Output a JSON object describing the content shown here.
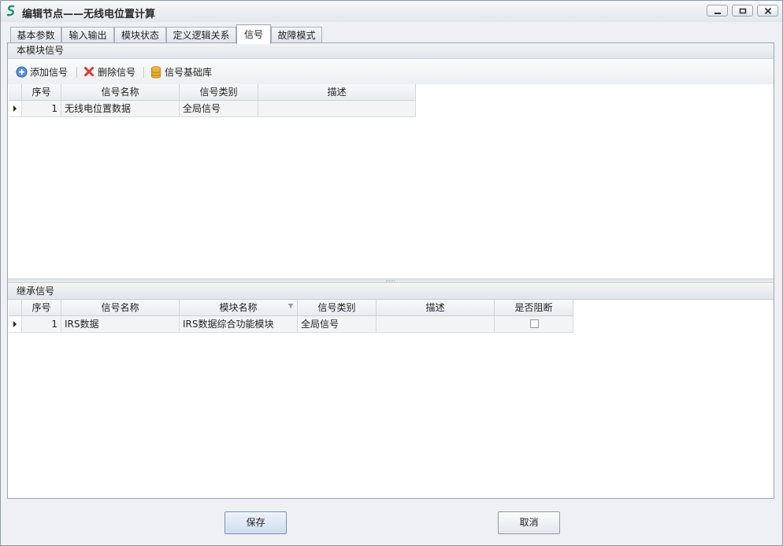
{
  "window": {
    "title": "编辑节点——无线电位置计算"
  },
  "tabs": [
    "基本参数",
    "输入输出",
    "模块状态",
    "定义逻辑关系",
    "信号",
    "故障模式"
  ],
  "active_tab": "信号",
  "module_signals": {
    "header": "本模块信号",
    "toolbar": {
      "add": "添加信号",
      "delete": "删除信号",
      "library": "信号基础库"
    },
    "columns": [
      "序号",
      "信号名称",
      "信号类别",
      "描述"
    ],
    "rows": [
      {
        "index": "1",
        "name": "无线电位置数据",
        "category": "全局信号",
        "desc": ""
      }
    ]
  },
  "inherited_signals": {
    "header": "继承信号",
    "columns": [
      "序号",
      "信号名称",
      "模块名称",
      "信号类别",
      "描述",
      "是否阻断"
    ],
    "rows": [
      {
        "index": "1",
        "name": "IRS数据",
        "module": "IRS数据综合功能模块",
        "category": "全局信号",
        "desc": "",
        "blocked": false
      }
    ]
  },
  "buttons": {
    "save": "保存",
    "cancel": "取消"
  }
}
